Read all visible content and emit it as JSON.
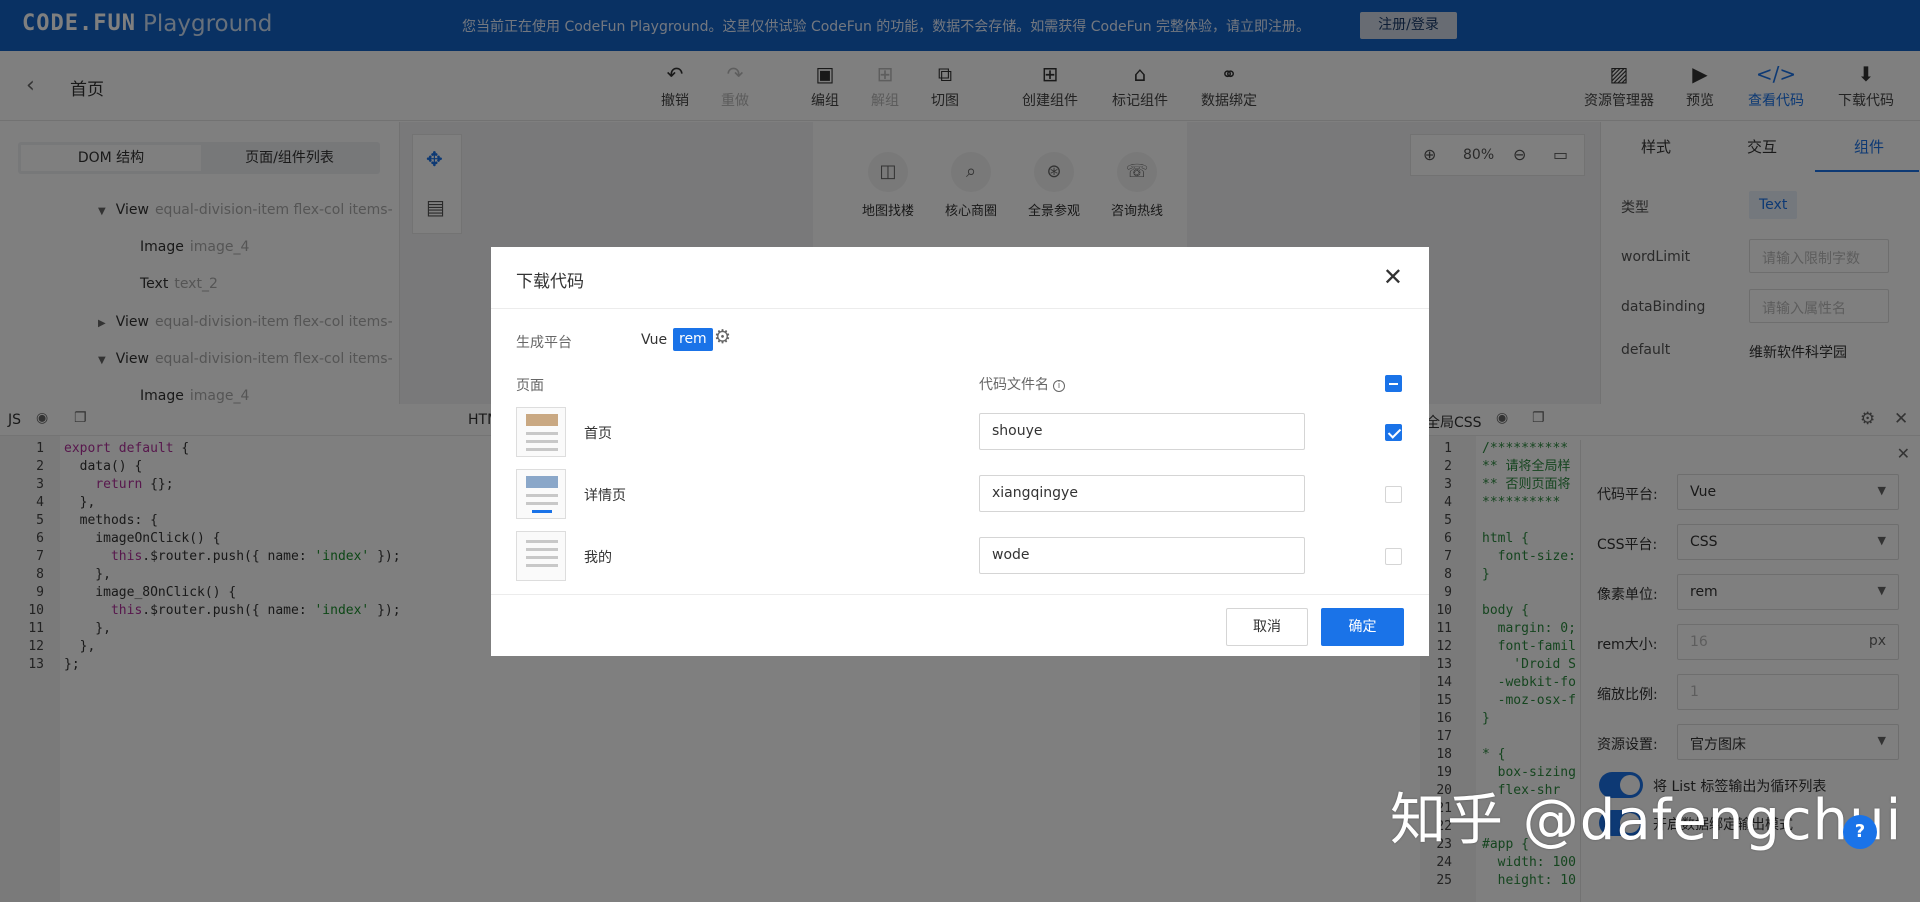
{
  "banner": {
    "logo": "CODE.FUN",
    "product": "Playground",
    "message": "您当前正在使用 CodeFun Playground。这里仅供试验 CodeFun 的功能，数据不会存储。如需获得 CodeFun 完整体验，请立即注册。",
    "register_label": "注册/登录"
  },
  "toolbar": {
    "back_icon": "‹",
    "page_title": "首页",
    "tools": [
      {
        "label": "撤销",
        "icon": "↶"
      },
      {
        "label": "重做",
        "icon": "↷"
      },
      {
        "label": "编组",
        "icon": "▣"
      },
      {
        "label": "解组",
        "icon": "⊞"
      },
      {
        "label": "切图",
        "icon": "⧉"
      },
      {
        "label": "创建组件",
        "icon": "⊞"
      },
      {
        "label": "标记组件",
        "icon": "⌂"
      },
      {
        "label": "数据绑定",
        "icon": "⚭"
      }
    ],
    "right_tools": [
      {
        "label": "资源管理器",
        "icon": "▨"
      },
      {
        "label": "预览",
        "icon": "▶"
      },
      {
        "label": "查看代码",
        "icon": "</>"
      },
      {
        "label": "下载代码",
        "icon": "⬇"
      }
    ]
  },
  "left_panel": {
    "tab_dom": "DOM 结构",
    "tab_pages": "页面/组件列表",
    "tree": [
      {
        "name": "View",
        "sub": "equal-division-item flex-col items-"
      },
      {
        "name": "Image",
        "sub": "image_4"
      },
      {
        "name": "Text",
        "sub": "text_2"
      },
      {
        "name": "View",
        "sub": "equal-division-item flex-col items-"
      },
      {
        "name": "View",
        "sub": "equal-division-item flex-col items-"
      },
      {
        "name": "Image",
        "sub": "image_4"
      }
    ]
  },
  "canvas": {
    "quick": [
      "地图找楼",
      "核心商圈",
      "全景参观",
      "咨询热线"
    ],
    "zoom": "80%"
  },
  "right_panel": {
    "tabs": [
      "样式",
      "交互",
      "组件"
    ],
    "type_label": "类型",
    "type_value": "Text",
    "word_limit_label": "wordLimit",
    "word_limit_placeholder": "请输入限制字数",
    "data_binding_label": "dataBinding",
    "data_binding_placeholder": "请输入属性名",
    "default_label": "default",
    "default_value": "维新软件科学园"
  },
  "editors": {
    "js_title": "JS",
    "html_title": "HTML",
    "css_title": "全局CSS",
    "js_lines": [
      "1",
      "2",
      "3",
      "4",
      "5",
      "6",
      "7",
      "8",
      "9",
      "10",
      "11",
      "12",
      "13"
    ],
    "css_lines": [
      "1",
      "2",
      "3",
      "4",
      "5",
      "6",
      "7",
      "8",
      "9",
      "10",
      "11",
      "12",
      "13",
      "14",
      "15",
      "16",
      "17",
      "18",
      "19",
      "20",
      "21",
      "22",
      "23",
      "24",
      "25"
    ],
    "css_code": "/**********\n** 请将全局样\n** 否则页面将\n**********\n\nhtml {\n  font-size:\n}\n\nbody {\n  margin: 0;\n  font-famil\n    'Droid S\n  -webkit-fo\n  -moz-osx-f\n}\n\n* {\n  box-sizing\n  flex-shr\n\n\n#app {\n  width: 100\n  height: 10"
  },
  "code_settings": {
    "platform_label": "代码平台:",
    "platform_value": "Vue",
    "css_label": "CSS平台:",
    "css_value": "CSS",
    "unit_label": "像素单位:",
    "unit_value": "rem",
    "rem_label": "rem大小:",
    "rem_value": "16",
    "rem_suffix": "px",
    "scale_label": "缩放比例:",
    "scale_value": "1",
    "resource_label": "资源设置:",
    "resource_value": "官方图床",
    "list_toggle_label": "将 List 标签输出为循环列表",
    "data_toggle_label": "开启数据绑定输出模式"
  },
  "dialog": {
    "title": "下载代码",
    "close_icon": "✕",
    "platform_label": "生成平台",
    "platform_vue": "Vue",
    "platform_rem": "rem",
    "col_page": "页面",
    "col_filename": "代码文件名",
    "rows": [
      {
        "name": "首页",
        "file": "shouye",
        "checked": true
      },
      {
        "name": "详情页",
        "file": "xiangqingye",
        "checked": false
      },
      {
        "name": "我的",
        "file": "wode",
        "checked": false
      }
    ],
    "cancel": "取消",
    "confirm": "确定"
  },
  "watermark": "知乎 @dafengchui",
  "help_icon": "?"
}
